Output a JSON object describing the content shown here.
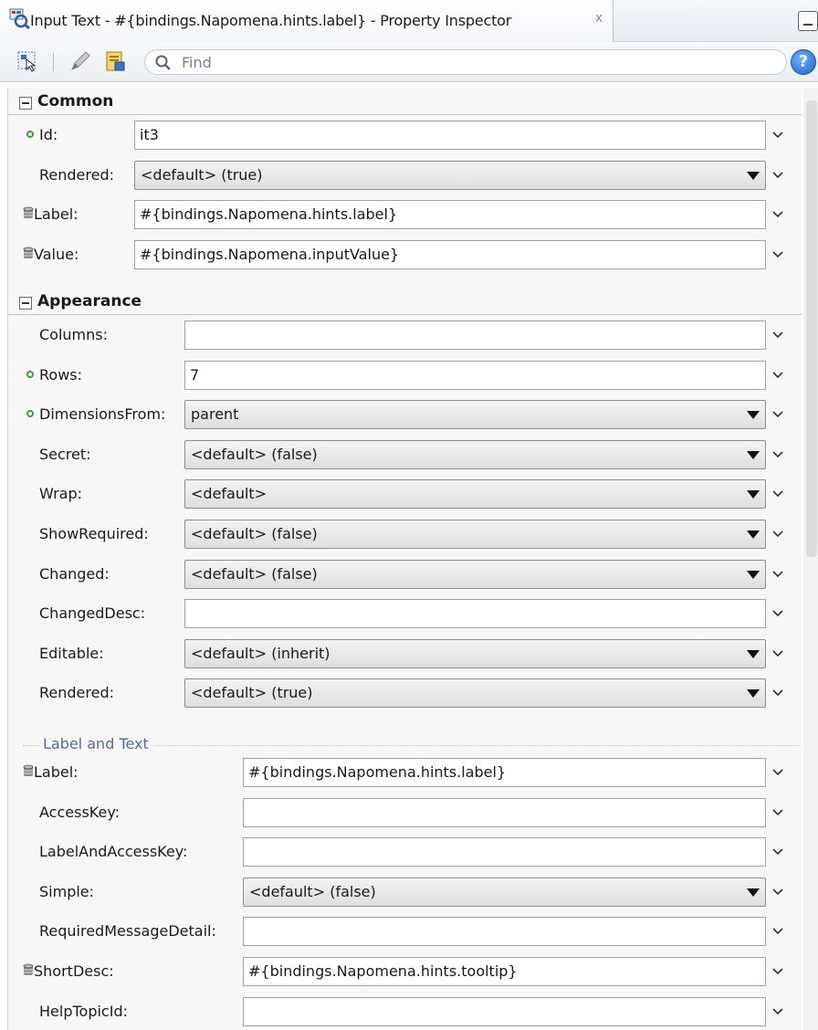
{
  "tab": {
    "title": "Input Text - #{bindings.Napomena.hints.label} - Property Inspector",
    "close_label": "x",
    "icon": "property-inspector-icon"
  },
  "toolbar": {
    "icons": [
      "select-component-icon",
      "pencil-icon",
      "bind-data-icon"
    ],
    "find_placeholder": "Find",
    "help_label": "?"
  },
  "sections": {
    "common": {
      "title": "Common",
      "rows": [
        {
          "label": "Id:",
          "value": "it3",
          "kind": "text",
          "marker": "required"
        },
        {
          "label": "Rendered:",
          "value": "<default> (true)",
          "kind": "select",
          "marker": "none"
        },
        {
          "label": "Label:",
          "value": "#{bindings.Napomena.hints.label}",
          "kind": "text",
          "marker": "binding"
        },
        {
          "label": "Value:",
          "value": "#{bindings.Napomena.inputValue}",
          "kind": "text",
          "marker": "binding"
        }
      ]
    },
    "appearance": {
      "title": "Appearance",
      "rows": [
        {
          "label": "Columns:",
          "value": "",
          "kind": "text",
          "marker": "none"
        },
        {
          "label": "Rows:",
          "value": "7",
          "kind": "text",
          "marker": "required"
        },
        {
          "label": "DimensionsFrom:",
          "value": "parent",
          "kind": "select",
          "marker": "required"
        },
        {
          "label": "Secret:",
          "value": "<default> (false)",
          "kind": "select",
          "marker": "none"
        },
        {
          "label": "Wrap:",
          "value": "<default>",
          "kind": "select",
          "marker": "none"
        },
        {
          "label": "ShowRequired:",
          "value": "<default> (false)",
          "kind": "select",
          "marker": "none"
        },
        {
          "label": "Changed:",
          "value": "<default> (false)",
          "kind": "select",
          "marker": "none"
        },
        {
          "label": "ChangedDesc:",
          "value": "",
          "kind": "text",
          "marker": "none"
        },
        {
          "label": "Editable:",
          "value": "<default> (inherit)",
          "kind": "select",
          "marker": "none"
        },
        {
          "label": "Rendered:",
          "value": "<default> (true)",
          "kind": "select",
          "marker": "none"
        }
      ]
    },
    "label_and_text": {
      "title": "Label and Text",
      "rows": [
        {
          "label": "Label:",
          "value": "#{bindings.Napomena.hints.label}",
          "kind": "text",
          "marker": "binding"
        },
        {
          "label": "AccessKey:",
          "value": "",
          "kind": "text",
          "marker": "none"
        },
        {
          "label": "LabelAndAccessKey:",
          "value": "",
          "kind": "text",
          "marker": "none"
        },
        {
          "label": "Simple:",
          "value": "<default> (false)",
          "kind": "select",
          "marker": "none"
        },
        {
          "label": "RequiredMessageDetail:",
          "value": "",
          "kind": "text",
          "marker": "none"
        },
        {
          "label": "ShortDesc:",
          "value": "#{bindings.Napomena.hints.tooltip}",
          "kind": "text",
          "marker": "binding"
        },
        {
          "label": "HelpTopicId:",
          "value": "",
          "kind": "text",
          "marker": "none"
        }
      ]
    }
  },
  "colors": {
    "required_marker": "#3e9b3e",
    "subsection_title": "#4d6e9a",
    "help_button": "#1f62c9"
  }
}
